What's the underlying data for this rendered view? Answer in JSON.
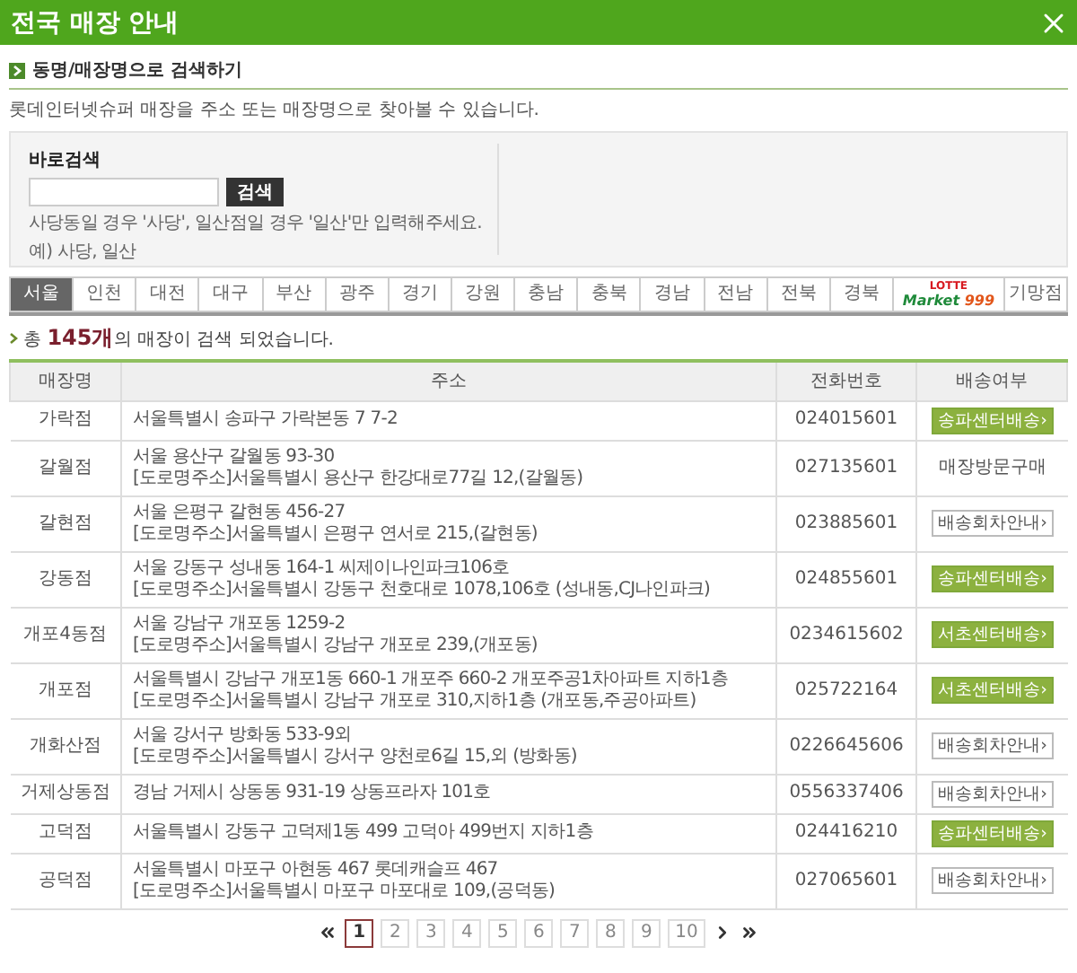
{
  "window": {
    "title": "전국 매장 안내"
  },
  "section": {
    "title": "동명/매장명으로 검색하기",
    "description": "롯데인터넷슈퍼 매장을 주소 또는 매장명으로 찾아볼 수 있습니다."
  },
  "search": {
    "label": "바로검색",
    "button": "검색",
    "hints": [
      "사당동일 경우 '사당', 일산점일 경우 '일산'만 입력해주세요.",
      "예) 사당, 일산"
    ]
  },
  "tabs": [
    {
      "kind": "text",
      "label": "서울",
      "selected": true
    },
    {
      "kind": "text",
      "label": "인천",
      "selected": false
    },
    {
      "kind": "text",
      "label": "대전",
      "selected": false
    },
    {
      "kind": "text",
      "label": "대구",
      "selected": false
    },
    {
      "kind": "text",
      "label": "부산",
      "selected": false
    },
    {
      "kind": "text",
      "label": "광주",
      "selected": false
    },
    {
      "kind": "text",
      "label": "경기",
      "selected": false
    },
    {
      "kind": "text",
      "label": "강원",
      "selected": false
    },
    {
      "kind": "text",
      "label": "충남",
      "selected": false
    },
    {
      "kind": "text",
      "label": "충북",
      "selected": false
    },
    {
      "kind": "text",
      "label": "경남",
      "selected": false
    },
    {
      "kind": "text",
      "label": "전남",
      "selected": false
    },
    {
      "kind": "text",
      "label": "전북",
      "selected": false
    },
    {
      "kind": "text",
      "label": "경북",
      "selected": false
    },
    {
      "kind": "logo",
      "label": "LOTTE",
      "sublabel": "Market",
      "number": "999",
      "selected": false
    },
    {
      "kind": "text",
      "label": "기망점",
      "selected": false
    }
  ],
  "result_count": "총 **145개**의 매장이 검색 되었습니다.",
  "table": {
    "columns": [
      "매장명",
      "주소",
      "전화번호",
      "배송여부"
    ],
    "rows": [
      {
        "name": "가락점",
        "address": [
          "서울특별시 송파구 가락본동 7  7-2"
        ],
        "phone": "024015601",
        "delivery": {
          "kind": "center",
          "label": "송파센터배송›"
        }
      },
      {
        "name": "갈월점",
        "address": [
          "서울 용산구 갈월동 93-30",
          "[도로명주소]서울특별시 용산구 한강대로77길 12,(갈월동)"
        ],
        "phone": "027135601",
        "delivery": {
          "kind": "plain",
          "label": "매장방문구매"
        }
      },
      {
        "name": "갈현점",
        "address": [
          "서울 은평구 갈현동 456-27",
          "[도로명주소]서울특별시 은평구 연서로 215,(갈현동)"
        ],
        "phone": "023885601",
        "delivery": {
          "kind": "info",
          "label": "배송회차안내›"
        }
      },
      {
        "name": "강동점",
        "address": [
          "서울 강동구 성내동 164-1 씨제이나인파크106호",
          "[도로명주소]서울특별시 강동구 천호대로 1078,106호 (성내동,CJ나인파크)"
        ],
        "phone": "024855601",
        "delivery": {
          "kind": "center",
          "label": "송파센터배송›"
        }
      },
      {
        "name": "개포4동점",
        "address": [
          "서울 강남구 개포동 1259-2",
          "[도로명주소]서울특별시 강남구 개포로 239,(개포동)"
        ],
        "phone": "0234615602",
        "delivery": {
          "kind": "center",
          "label": "서초센터배송›"
        }
      },
      {
        "name": "개포점",
        "address": [
          "서울특별시 강남구 개포1동 660-1 개포주  660-2 개포주공1차아파트 지하1층",
          "[도로명주소]서울특별시 강남구 개포로 310,지하1층 (개포동,주공아파트)"
        ],
        "phone": "025722164",
        "delivery": {
          "kind": "center",
          "label": "서초센터배송›"
        }
      },
      {
        "name": "개화산점",
        "address": [
          "서울 강서구 방화동 533-9외",
          "[도로명주소]서울특별시 강서구 양천로6길 15,외 (방화동)"
        ],
        "phone": "0226645606",
        "delivery": {
          "kind": "info",
          "label": "배송회차안내›"
        }
      },
      {
        "name": "거제상동점",
        "address": [
          "경남 거제시 상동동 931-19 상동프라자 101호"
        ],
        "phone": "0556337406",
        "delivery": {
          "kind": "info",
          "label": "배송회차안내›"
        }
      },
      {
        "name": "고덕점",
        "address": [
          "서울특별시 강동구 고덕제1동 499 고덕아  499번지 지하1층"
        ],
        "phone": "024416210",
        "delivery": {
          "kind": "center",
          "label": "송파센터배송›"
        }
      },
      {
        "name": "공덕점",
        "address": [
          "서울특별시 마포구 아현동 467 롯데캐슬프  467",
          "[도로명주소]서울특별시 마포구 마포대로 109,(공덕동)"
        ],
        "phone": "027065601",
        "delivery": {
          "kind": "info",
          "label": "배송회차안내›"
        }
      }
    ]
  },
  "pagination": {
    "pages": [
      {
        "label": "1",
        "selected": true
      },
      {
        "label": "2",
        "selected": false
      },
      {
        "label": "3",
        "selected": false
      },
      {
        "label": "4",
        "selected": false
      },
      {
        "label": "5",
        "selected": false
      },
      {
        "label": "6",
        "selected": false
      },
      {
        "label": "7",
        "selected": false
      },
      {
        "label": "8",
        "selected": false
      },
      {
        "label": "9",
        "selected": false
      },
      {
        "label": "10",
        "selected": false
      }
    ]
  }
}
